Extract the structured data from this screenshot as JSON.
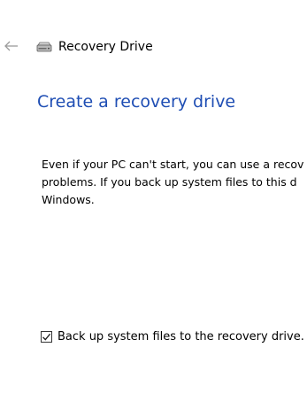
{
  "window": {
    "title": "Recovery Drive",
    "icon": "drive-icon"
  },
  "navigation": {
    "back_icon": "back-arrow-icon"
  },
  "main": {
    "heading": "Create a recovery drive",
    "description_lines": [
      "Even if your PC can't start, you can use a recov",
      "problems. If you back up system files to this d",
      "Windows."
    ],
    "backup_option": {
      "label": "Back up system files to the recovery drive.",
      "checked": true,
      "icon": "checkmark-icon"
    }
  },
  "colors": {
    "heading": "#1f4eb4",
    "back_arrow": "#9a9a9a",
    "background": "#ffffff"
  }
}
